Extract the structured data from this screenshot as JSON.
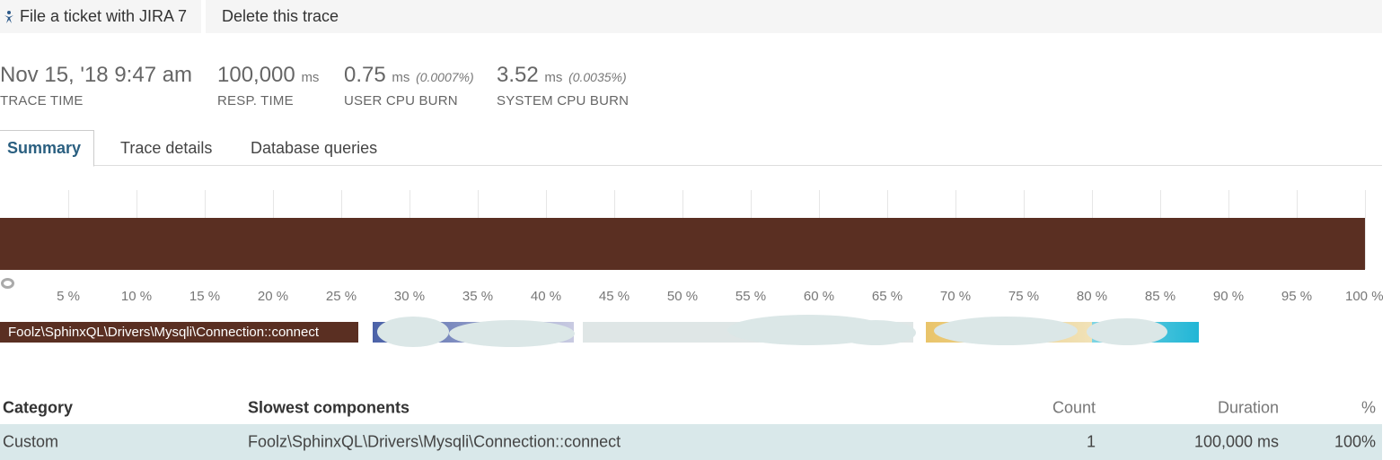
{
  "actions": {
    "jira_label": "File a ticket with JIRA 7",
    "jira_icon": "jira-icon",
    "delete_label": "Delete this trace"
  },
  "metrics": [
    {
      "value": "Nov 15, '18 9:47 am",
      "unit": "",
      "pct": "",
      "label": "TRACE TIME"
    },
    {
      "value": "100,000",
      "unit": "ms",
      "pct": "",
      "label": "RESP. TIME"
    },
    {
      "value": "0.75",
      "unit": "ms",
      "pct": "(0.0007%)",
      "label": "USER CPU BURN"
    },
    {
      "value": "3.52",
      "unit": "ms",
      "pct": "(0.0035%)",
      "label": "SYSTEM CPU BURN"
    }
  ],
  "tabs": [
    {
      "label": "Summary",
      "active": true
    },
    {
      "label": "Trace details",
      "active": false
    },
    {
      "label": "Database queries",
      "active": false
    }
  ],
  "chart_data": {
    "type": "bar",
    "orientation": "horizontal",
    "ticks": [
      "5 %",
      "10 %",
      "15 %",
      "20 %",
      "25 %",
      "30 %",
      "35 %",
      "40 %",
      "45 %",
      "50 %",
      "55 %",
      "60 %",
      "65 %",
      "70 %",
      "75 %",
      "80 %",
      "85 %",
      "90 %",
      "95 %",
      "100 %"
    ],
    "xlim": [
      0,
      100
    ],
    "segments": [
      {
        "name": "Foolz\\SphinxQL\\Drivers\\Mysqli\\Connection::connect",
        "start": 0,
        "end": 100,
        "color": "#5a2f22"
      }
    ]
  },
  "legend": [
    {
      "label": "Foolz\\SphinxQL\\Drivers\\Mysqli\\Connection::connect",
      "color": "#5a2f22"
    },
    {
      "label": "",
      "color": "#4b62a8"
    },
    {
      "label": "",
      "color": "#dfe6e6"
    },
    {
      "label": "",
      "color": "#e9c46a"
    },
    {
      "label": "",
      "color": "#21b6d6"
    }
  ],
  "table": {
    "headers": {
      "category": "Category",
      "components": "Slowest components",
      "count": "Count",
      "duration": "Duration",
      "pct": "%"
    },
    "rows": [
      {
        "category": "Custom",
        "component": "Foolz\\SphinxQL\\Drivers\\Mysqli\\Connection::connect",
        "count": "1",
        "duration": "100,000 ms",
        "pct": "100%"
      }
    ]
  }
}
